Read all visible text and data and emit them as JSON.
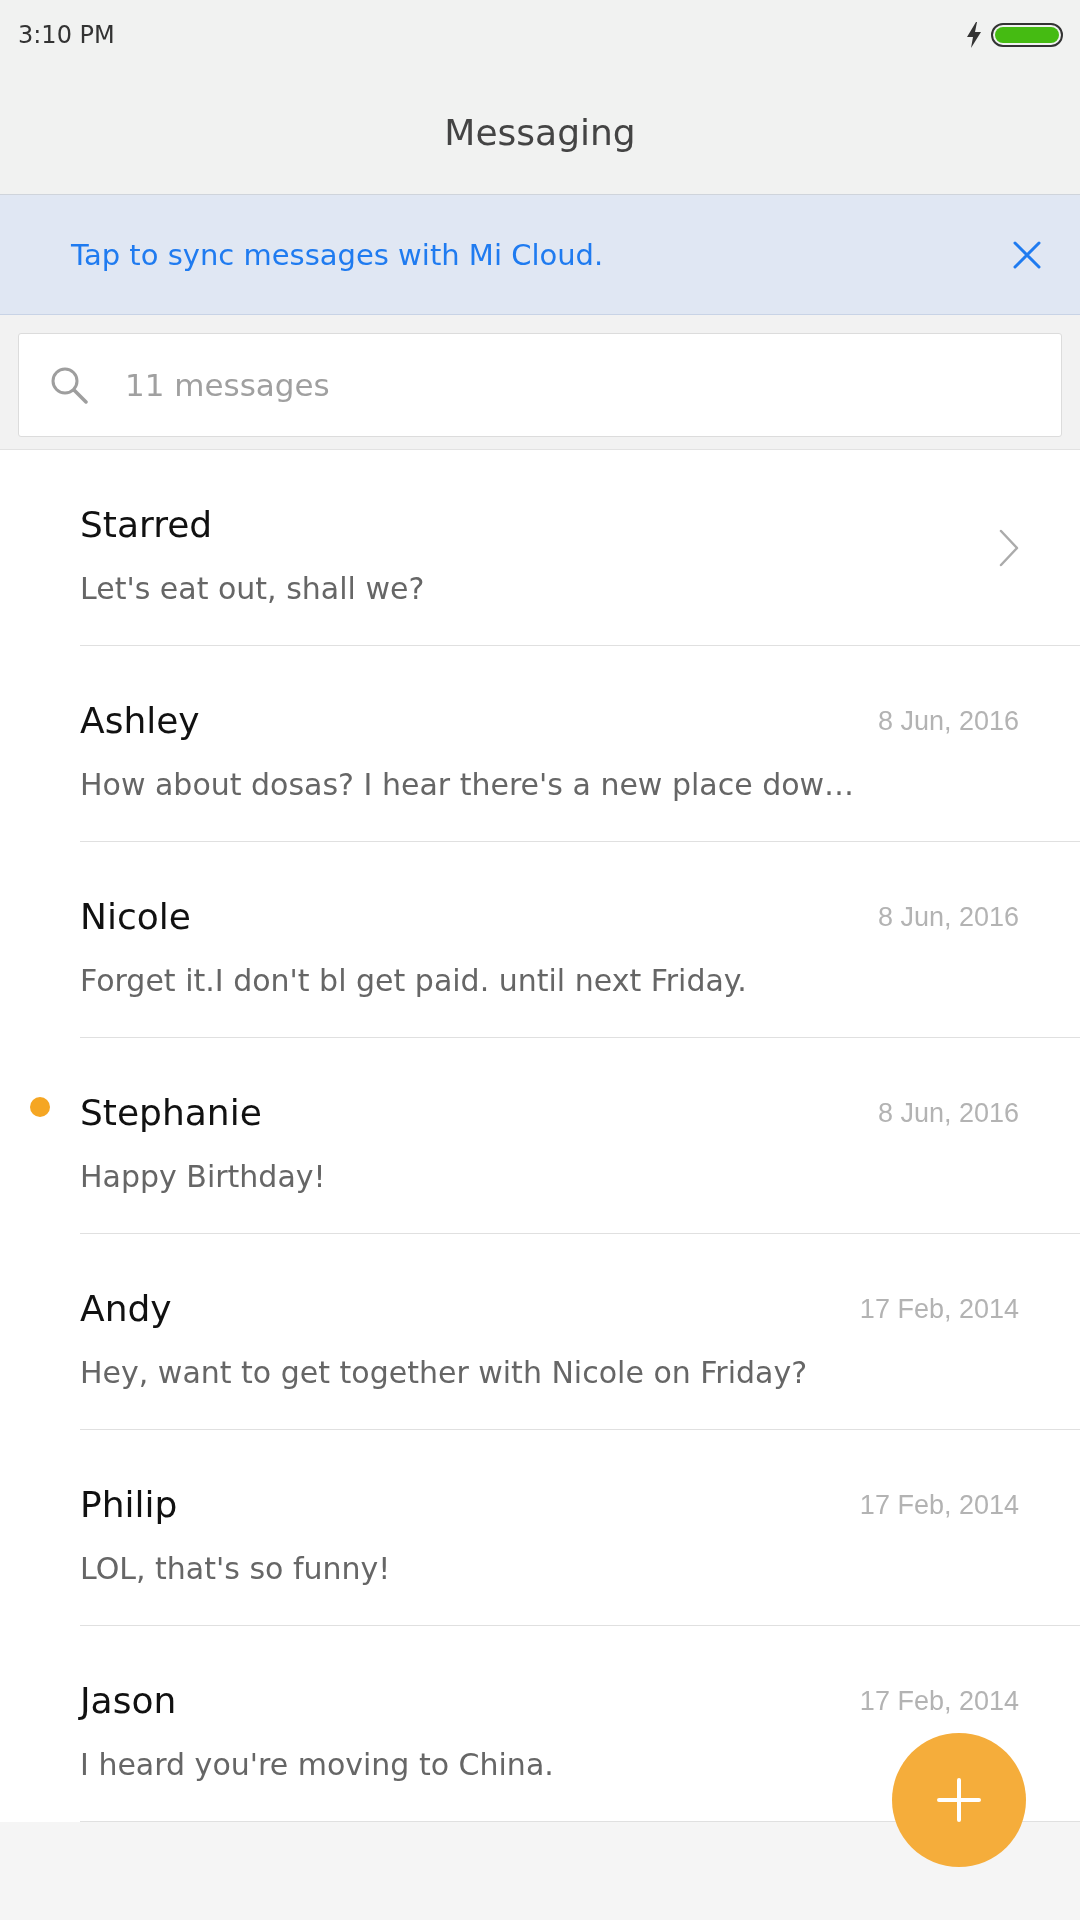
{
  "status_bar": {
    "time": "3:10 PM",
    "charging": true
  },
  "app_bar": {
    "title": "Messaging"
  },
  "sync_banner": {
    "text": "Tap to sync messages with Mi Cloud."
  },
  "search": {
    "placeholder": "11 messages"
  },
  "conversations": [
    {
      "kind": "folder",
      "name": "Starred",
      "preview": "Let's eat out, shall we?",
      "unread": false
    },
    {
      "kind": "thread",
      "name": "Ashley",
      "date": "8 Jun, 2016",
      "preview": "How about dosas? I hear there's a new place dow…",
      "unread": false
    },
    {
      "kind": "thread",
      "name": "Nicole",
      "date": "8 Jun, 2016",
      "preview": "Forget it.I don't bl get paid. until next Friday.",
      "unread": false
    },
    {
      "kind": "thread",
      "name": "Stephanie",
      "date": "8 Jun, 2016",
      "preview": "Happy Birthday!",
      "unread": true
    },
    {
      "kind": "thread",
      "name": "Andy",
      "date": "17 Feb, 2014",
      "preview": "Hey, want to get together with Nicole on Friday?",
      "unread": false
    },
    {
      "kind": "thread",
      "name": "Philip",
      "date": "17 Feb, 2014",
      "preview": "LOL, that's so funny!",
      "unread": false
    },
    {
      "kind": "thread",
      "name": "Jason",
      "date": "17 Feb, 2014",
      "preview": "I heard you're moving to China.",
      "unread": false
    }
  ]
}
